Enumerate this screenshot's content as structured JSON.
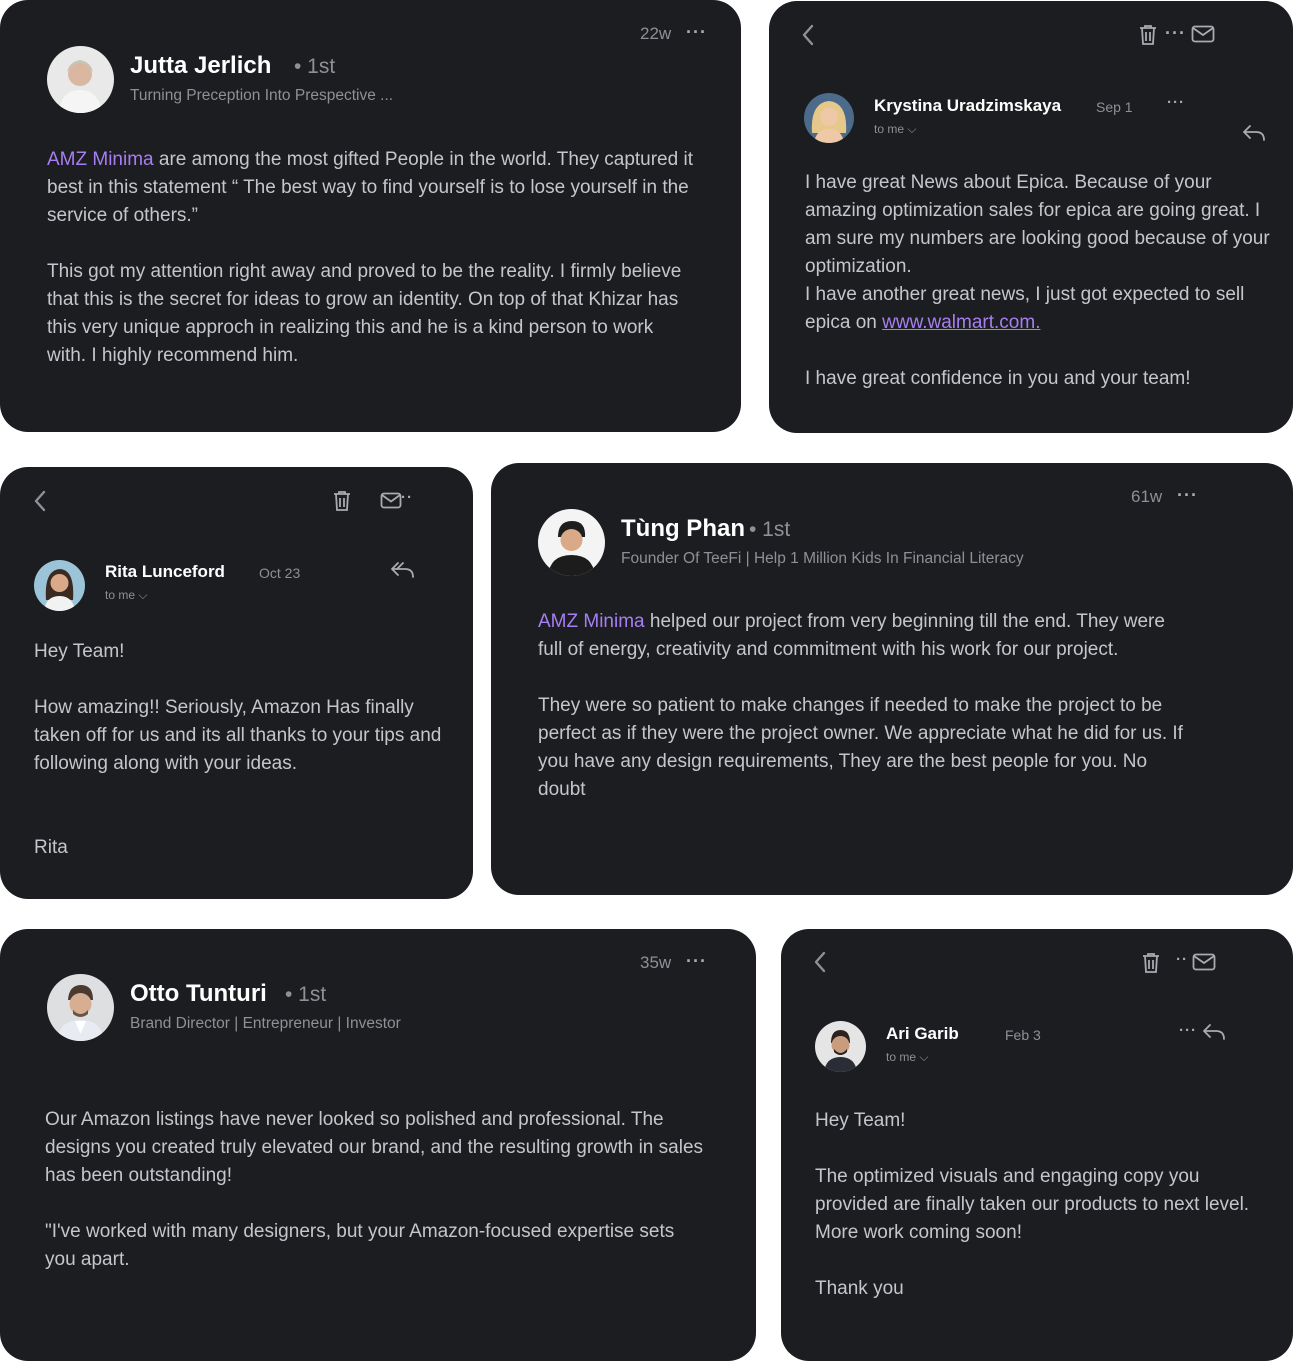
{
  "colors": {
    "card_bg": "#1c1d21",
    "page_bg": "#ffffff",
    "accent": "#a77ef2",
    "text": "#c4c6cb",
    "muted": "#8e9096"
  },
  "card1": {
    "time": "22w",
    "name": "Jutta Jerlich",
    "degree": "• 1st",
    "headline": "Turning Preception Into Prespective ...",
    "brand": "AMZ Minima",
    "p1_rest": " are among the most gifted People in the world. They captured it best in this statement “ The best way to find yourself is to lose yourself in the service of others.”",
    "p2": "This got my attention right away and proved to be the reality. I firmly believe that this is the secret for ideas to grow an identity. On top of that Khizar has this very unique approch in realizing this and he is a kind person to work with. I highly recommend him."
  },
  "card2": {
    "name": "Krystina Uradzimskaya",
    "date": "Sep 1",
    "to_me": "to me",
    "p1": "I have great News about Epica. Because of your amazing optimization sales for epica are going great. I am sure my numbers are looking good because of your optimization.",
    "p2_before": "I have another great news, I just got expected to sell epica on ",
    "link": "www.walmart.com.",
    "p3": "I have great confidence in you and your team!"
  },
  "card3": {
    "name": "Rita Lunceford",
    "date": "Oct 23",
    "to_me": "to me",
    "greeting": "Hey Team!",
    "p1": "How amazing!!  Seriously, Amazon Has finally taken off for us and its all thanks to your tips and following along with your ideas.",
    "sign": "Rita"
  },
  "card4": {
    "time": "61w",
    "name": "Tùng Phan",
    "degree": "• 1st",
    "headline": "Founder Of TeeFi | Help 1 Million Kids In Financial Literacy",
    "brand": "AMZ Minima",
    "p1_rest": " helped our project from very beginning till the end. They were full of energy, creativity and commitment with his work for our project.",
    "p2": "They were so patient to make changes if needed to make the project to be perfect as if they were the project owner. We appreciate what he did for us. If you have any design requirements, They are the best people for you. No doubt"
  },
  "card5": {
    "time": "35w",
    "name": "Otto Tunturi",
    "degree": "• 1st",
    "headline": "Brand Director | Entrepreneur | Investor",
    "p1": "Our Amazon listings have never looked so polished and professional. The designs you created truly elevated our brand, and the resulting growth in sales has been outstanding!",
    "p2": "\"I've worked with many designers, but your Amazon-focused expertise sets you apart."
  },
  "card6": {
    "name": "Ari Garib",
    "date": "Feb 3",
    "to_me": "to me",
    "greeting": "Hey Team!",
    "p1": "The optimized visuals and engaging copy you provided are finally taken our products to next level. More work coming soon!",
    "sign": "Thank you"
  }
}
